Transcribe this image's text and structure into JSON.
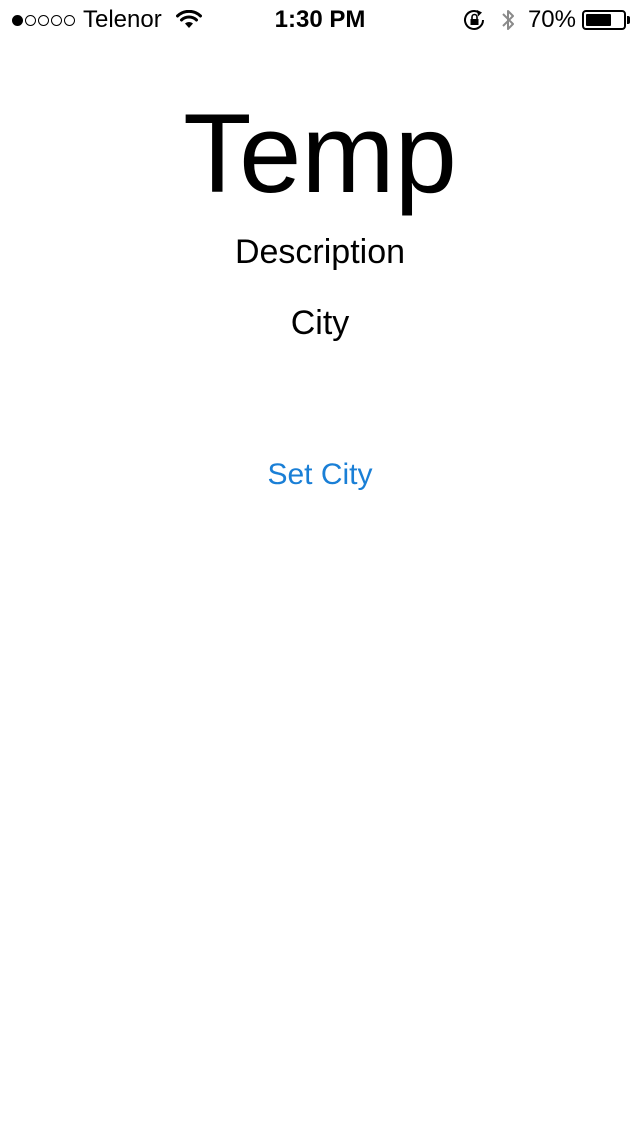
{
  "status_bar": {
    "signal": {
      "filled": 1,
      "total": 5
    },
    "carrier": "Telenor",
    "time": "1:30 PM",
    "battery_percent_label": "70%",
    "battery_level": 0.7,
    "icons": [
      "wifi-icon",
      "rotation-lock-icon",
      "bluetooth-icon",
      "battery-icon"
    ]
  },
  "weather": {
    "temp": "Temp",
    "description": "Description",
    "city": "City"
  },
  "actions": {
    "set_city_label": "Set City"
  },
  "colors": {
    "link": "#1a7fd6",
    "text": "#000000",
    "background": "#ffffff"
  }
}
